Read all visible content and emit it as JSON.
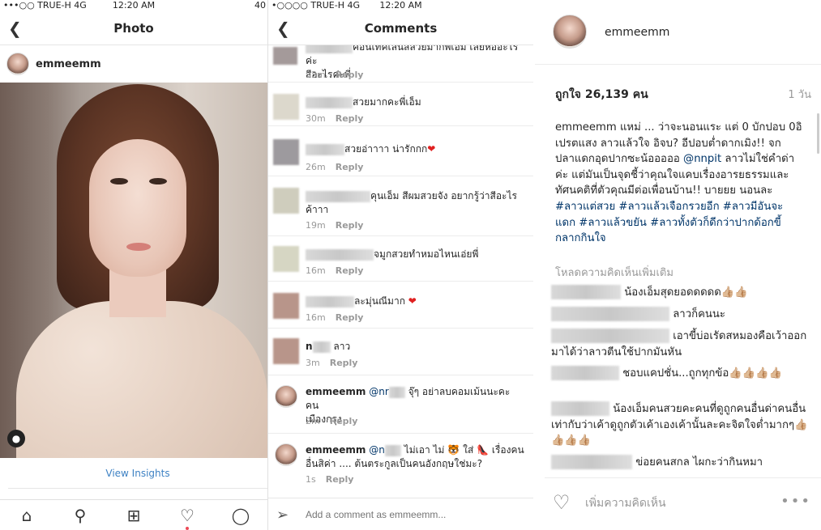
{
  "left": {
    "status": {
      "carrier": "•••○○ TRUE-H  4G",
      "time": "12:20 AM",
      "right": "40"
    },
    "nav": {
      "back_icon": "chevron-left-icon",
      "title": "Photo"
    },
    "post": {
      "username": "emmeemm"
    },
    "insights_label": "View Insights",
    "tabs": [
      "home-icon",
      "search-icon",
      "add-icon",
      "heart-icon",
      "profile-icon"
    ]
  },
  "middle": {
    "status": {
      "carrier": "•○○○○ TRUE-H  4G",
      "time": "12:20 AM"
    },
    "nav": {
      "title": "Comments"
    },
    "comments": [
      {
        "text_a": "คอนเทคเลนส์สวยมากพี่เอ็ม  เลยหออะไรค่ะ",
        "text_b": "สีอะไรค่ะพี่",
        "time": "33m",
        "reply": "Reply"
      },
      {
        "text": "สวยมากคะพี่เอ็ม",
        "time": "30m",
        "reply": "Reply"
      },
      {
        "text": "สวยอ่าาาา น่ารักกก",
        "time": "26m",
        "reply": "Reply"
      },
      {
        "text_a": "คุนเอ็ม สีผมสวยจัง อยากรู้ว่าสีอะไร",
        "text_b": "ค้าาา",
        "time": "19m",
        "reply": "Reply"
      },
      {
        "text": "จมูกสวยทำหมอไหนเอ่ยพี่",
        "time": "16m",
        "reply": "Reply"
      },
      {
        "text": "ละมุ่นณีมาก",
        "time": "16m",
        "reply": "Reply"
      },
      {
        "user": "n",
        "text": "ลาว",
        "time": "3m",
        "reply": "Reply"
      },
      {
        "user": "emmeemm",
        "mention": "@nr",
        "text_a": "จุ๊ๆ อย่าลบคอมเม้นนะคะ คน",
        "text_b": "เมืองกรุง",
        "time": "2m",
        "reply": "Reply"
      },
      {
        "user": "emmeemm",
        "mention": "@n",
        "text_a": "ไม่เอา ไม่",
        "text_a2": "ใส่",
        "text_a3": "เรื่องคน",
        "text_b": "อื่นสิค่า .... ต้นตระกูลเป็นคนอังกฤษใช่มะ?",
        "time": "1s",
        "reply": "Reply"
      }
    ],
    "add_comment_placeholder": "Add a comment as emmeemm..."
  },
  "right": {
    "username": "emmeemm",
    "likes": "ถูกใจ 26,139 คน",
    "ago": "1 วัน",
    "caption": {
      "user": "emmeemm",
      "text1": "แหม่ ... ว่าจะนอนแระ แต่ 0 บักปอบ 0อิเปรตแสง ลาวแล้วใจ อิจบ? อีปอบต่ำดากเมิง!! จกปลาแดกอุดปากซะน้อออออ",
      "mention": "@nnpit",
      "text2": "ลาวไม่ใช่คำด่าค่ะ แต่มันเป็นจุดชี้ว่าคุณใจแคบเรื่องอารยธรรมและทัศนคติที่ตัวคุณมีต่อเพื่อนบ้าน!! บายยย นอนละ",
      "tags": [
        "#ลาวแต่สวย",
        "#ลาวแล้วเจือกรวยอีก",
        "#ลาวมีอันจะแดก",
        "#ลาวแล้วขยัน",
        "#ลาวทั้งตัวก็ดีกว่าปากด้อกขี้กลากกินใจ"
      ]
    },
    "load_more": "โหลดความคิดเห็นเพิ่มเติม",
    "comments": [
      {
        "text": "น้องเอ็มสุดยอดดดดด👍🏼👍🏼"
      },
      {
        "text": "ลาวก็คนนะ"
      },
      {
        "text": "เอาขี้บ่อเรัดสหมองคือเว้าออกมาได้ว่าลาวตีนใช้ปากมันหัน"
      },
      {
        "text": "ชอบแคปชั่น...ถูกทุกข้อ👍🏼👍🏼👍🏼👍🏼"
      },
      {
        "text": "น้องเอ็มคนสวยคะคนที่ดูถูกคนอื่นด่าคนอื่นเท่ากับว่าเค้าดูถูกตัวเค้าเองเค้านั้นละคะจิตใจต่ำมากๆ👍🏼👍🏼👍🏼👍🏼"
      },
      {
        "text": "ข่อยคนสกล ไผกะว่ากินหมา"
      }
    ],
    "add_comment": "เพิ่มความคิดเห็น",
    "more": "•••"
  }
}
